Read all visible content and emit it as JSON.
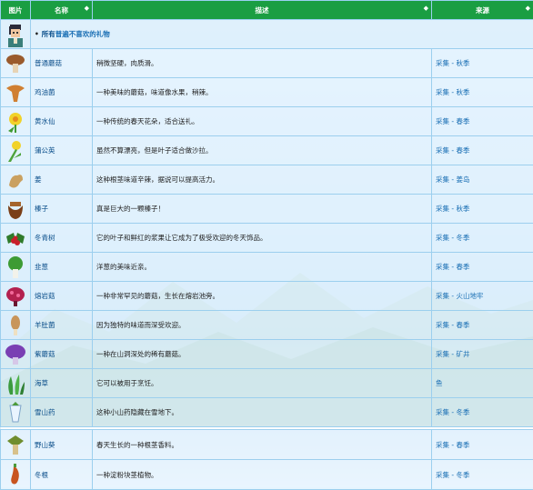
{
  "headers": {
    "picture": "图片",
    "name": "名称",
    "description": "描述",
    "source": "来源"
  },
  "banner": {
    "prefix": "所有",
    "link": "普遍不喜欢的礼物"
  },
  "items": [
    {
      "name": "普通蘑菇",
      "description": "稍微坚硬，肉质滑。",
      "source": "采集 - 秋季",
      "icon": "common-mushroom-icon"
    },
    {
      "name": "鸡油菌",
      "description": "一种美味的蘑菇，味道像水果，稍辣。",
      "source": "采集 - 秋季",
      "icon": "chanterelle-icon"
    },
    {
      "name": "黄水仙",
      "description": "一种传统的春天花朵，适合送礼。",
      "source": "采集 - 春季",
      "icon": "daffodil-icon"
    },
    {
      "name": "蒲公英",
      "description": "虽然不算漂亮，但是叶子适合做沙拉。",
      "source": "采集 - 春季",
      "icon": "dandelion-icon"
    },
    {
      "name": "姜",
      "description": "这种根茎味道辛辣，据说可以提高活力。",
      "source": "采集 - 姜岛",
      "icon": "ginger-icon"
    },
    {
      "name": "榛子",
      "description": "真是巨大的一颗榛子！",
      "source": "采集 - 秋季",
      "icon": "hazelnut-icon"
    },
    {
      "name": "冬青树",
      "description": "它的叶子和鲜红的浆果让它成为了极受欢迎的冬天饰品。",
      "source": "采集 - 冬季",
      "icon": "holly-icon"
    },
    {
      "name": "韭葱",
      "description": "洋葱的美味近亲。",
      "source": "采集 - 春季",
      "icon": "leek-icon"
    },
    {
      "name": "熔岩菇",
      "description": "一种非常罕见的蘑菇，生长在熔岩池旁。",
      "source": "采集 - 火山地牢",
      "icon": "magma-cap-icon"
    },
    {
      "name": "羊肚菌",
      "description": "因为独特的味道而深受欢迎。",
      "source": "采集 - 春季",
      "icon": "morel-icon"
    },
    {
      "name": "紫蘑菇",
      "description": "一种在山洞深处的稀有蘑菇。",
      "source": "采集 - 矿井",
      "icon": "purple-mushroom-icon"
    },
    {
      "name": "海草",
      "description": "它可以被用于烹饪。",
      "source": "鱼",
      "icon": "seaweed-icon"
    },
    {
      "name": "雪山药",
      "description": "这种小山药隐藏在雪地下。",
      "source": "采集 - 冬季",
      "icon": "snow-yam-icon"
    },
    {
      "name": "野山葵",
      "description": "春天生长的一种根茎香料。",
      "source": "采集 - 春季",
      "icon": "wild-horseradish-icon"
    },
    {
      "name": "冬根",
      "description": "一种淀粉块茎植物。",
      "source": "采集 - 冬季",
      "icon": "winter-root-icon"
    }
  ]
}
